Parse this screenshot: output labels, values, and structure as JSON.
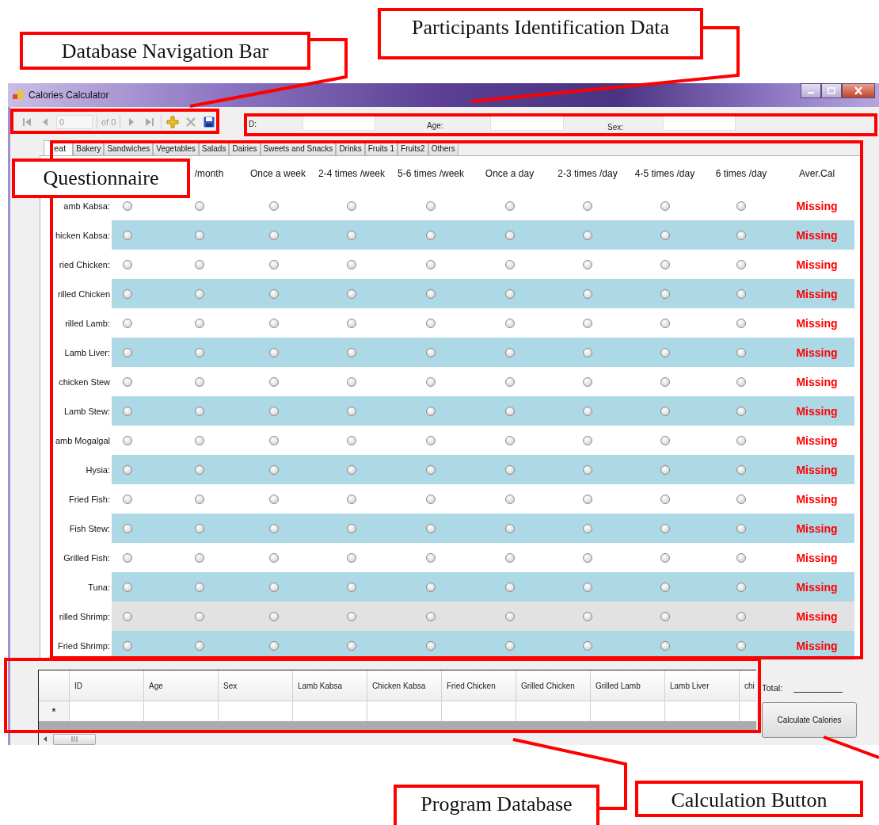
{
  "window": {
    "title": "Calories Calculator"
  },
  "navigator": {
    "items": [
      {
        "kind": "first",
        "disabled": true
      },
      {
        "kind": "previous",
        "disabled": true
      },
      {
        "kind": "position",
        "value": "0"
      },
      {
        "kind": "count",
        "text": "of 0"
      },
      {
        "kind": "next",
        "disabled": true
      },
      {
        "kind": "last",
        "disabled": true
      },
      {
        "kind": "add",
        "disabled": false
      },
      {
        "kind": "delete",
        "disabled": true
      },
      {
        "kind": "save",
        "disabled": false
      }
    ]
  },
  "participant": {
    "fields": [
      {
        "label": "D:"
      },
      {
        "label": "Age:"
      },
      {
        "label": "Sex:"
      }
    ]
  },
  "tabs": [
    {
      "label": "eat",
      "selected": true
    },
    {
      "label": "Bakery",
      "selected": false
    },
    {
      "label": "Sandwiches",
      "selected": false
    },
    {
      "label": "Vegetables",
      "selected": false
    },
    {
      "label": "Salads",
      "selected": false
    },
    {
      "label": "Dairies",
      "selected": false
    },
    {
      "label": "Sweets and Snacks",
      "selected": false
    },
    {
      "label": "Drinks",
      "selected": false
    },
    {
      "label": "Fruits 1",
      "selected": false
    },
    {
      "label": "Fruits2",
      "selected": false
    },
    {
      "label": "Others",
      "selected": false
    }
  ],
  "questionnaire": {
    "columns": [
      {
        "kind": "option"
      },
      {
        "kind": "option",
        "header": "/month"
      },
      {
        "kind": "option",
        "header": "Once a week"
      },
      {
        "kind": "option",
        "header": "2-4 times /week"
      },
      {
        "kind": "option",
        "header": "5-6 times /week"
      },
      {
        "kind": "option",
        "header": "Once a day"
      },
      {
        "kind": "option",
        "header": "2-3 times /day"
      },
      {
        "kind": "option",
        "header": "4-5 times /day"
      },
      {
        "kind": "option",
        "header": "6 times /day"
      },
      {
        "kind": "average",
        "header": "Aver.Cal"
      }
    ],
    "rows": [
      {
        "label": "amb Kabsa:",
        "striped": false,
        "hovered": false,
        "average": "Missing",
        "options": [
          {
            "selected": false
          },
          {
            "selected": false
          },
          {
            "selected": false
          },
          {
            "selected": false
          },
          {
            "selected": false
          },
          {
            "selected": false
          },
          {
            "selected": false
          },
          {
            "selected": false
          },
          {
            "selected": false
          }
        ]
      },
      {
        "label": "hicken Kabsa:",
        "striped": true,
        "hovered": false,
        "average": "Missing",
        "options": [
          {
            "selected": false
          },
          {
            "selected": false
          },
          {
            "selected": false
          },
          {
            "selected": false
          },
          {
            "selected": false
          },
          {
            "selected": false
          },
          {
            "selected": false
          },
          {
            "selected": false
          },
          {
            "selected": false
          }
        ]
      },
      {
        "label": "ried Chicken:",
        "striped": false,
        "hovered": false,
        "average": "Missing",
        "options": [
          {
            "selected": false
          },
          {
            "selected": false
          },
          {
            "selected": false
          },
          {
            "selected": false
          },
          {
            "selected": false
          },
          {
            "selected": false
          },
          {
            "selected": false
          },
          {
            "selected": false
          },
          {
            "selected": false
          }
        ]
      },
      {
        "label": "rilled Chicken",
        "striped": true,
        "hovered": false,
        "average": "Missing",
        "options": [
          {
            "selected": false
          },
          {
            "selected": false
          },
          {
            "selected": false
          },
          {
            "selected": false
          },
          {
            "selected": false
          },
          {
            "selected": false
          },
          {
            "selected": false
          },
          {
            "selected": false
          },
          {
            "selected": false
          }
        ]
      },
      {
        "label": "rilled Lamb:",
        "striped": false,
        "hovered": false,
        "average": "Missing",
        "options": [
          {
            "selected": false
          },
          {
            "selected": false
          },
          {
            "selected": false
          },
          {
            "selected": false
          },
          {
            "selected": false
          },
          {
            "selected": false
          },
          {
            "selected": false
          },
          {
            "selected": false
          },
          {
            "selected": false
          }
        ]
      },
      {
        "label": "Lamb Liver:",
        "striped": true,
        "hovered": false,
        "average": "Missing",
        "options": [
          {
            "selected": false
          },
          {
            "selected": false
          },
          {
            "selected": false
          },
          {
            "selected": false
          },
          {
            "selected": false
          },
          {
            "selected": false
          },
          {
            "selected": false
          },
          {
            "selected": false
          },
          {
            "selected": false
          }
        ]
      },
      {
        "label": "chicken Stew",
        "striped": false,
        "hovered": false,
        "average": "Missing",
        "options": [
          {
            "selected": false
          },
          {
            "selected": false
          },
          {
            "selected": false
          },
          {
            "selected": false
          },
          {
            "selected": false
          },
          {
            "selected": false
          },
          {
            "selected": false
          },
          {
            "selected": false
          },
          {
            "selected": false
          }
        ]
      },
      {
        "label": "Lamb Stew:",
        "striped": true,
        "hovered": false,
        "average": "Missing",
        "options": [
          {
            "selected": false
          },
          {
            "selected": false
          },
          {
            "selected": false
          },
          {
            "selected": false
          },
          {
            "selected": false
          },
          {
            "selected": false
          },
          {
            "selected": false
          },
          {
            "selected": false
          },
          {
            "selected": false
          }
        ]
      },
      {
        "label": "amb Mogalgal",
        "striped": false,
        "hovered": false,
        "average": "Missing",
        "options": [
          {
            "selected": false
          },
          {
            "selected": false
          },
          {
            "selected": false
          },
          {
            "selected": false
          },
          {
            "selected": false
          },
          {
            "selected": false
          },
          {
            "selected": false
          },
          {
            "selected": false
          },
          {
            "selected": false
          }
        ]
      },
      {
        "label": "Hysia:",
        "striped": true,
        "hovered": false,
        "average": "Missing",
        "options": [
          {
            "selected": false
          },
          {
            "selected": false
          },
          {
            "selected": false
          },
          {
            "selected": false
          },
          {
            "selected": false
          },
          {
            "selected": false
          },
          {
            "selected": false
          },
          {
            "selected": false
          },
          {
            "selected": false
          }
        ]
      },
      {
        "label": "Fried Fish:",
        "striped": false,
        "hovered": false,
        "average": "Missing",
        "options": [
          {
            "selected": false
          },
          {
            "selected": false
          },
          {
            "selected": false
          },
          {
            "selected": false
          },
          {
            "selected": false
          },
          {
            "selected": false
          },
          {
            "selected": false
          },
          {
            "selected": false
          },
          {
            "selected": false
          }
        ]
      },
      {
        "label": "Fish Stew:",
        "striped": true,
        "hovered": false,
        "average": "Missing",
        "options": [
          {
            "selected": false
          },
          {
            "selected": false
          },
          {
            "selected": false
          },
          {
            "selected": false
          },
          {
            "selected": false
          },
          {
            "selected": false
          },
          {
            "selected": false
          },
          {
            "selected": false
          },
          {
            "selected": false
          }
        ]
      },
      {
        "label": "Grilled Fish:",
        "striped": false,
        "hovered": false,
        "average": "Missing",
        "options": [
          {
            "selected": false
          },
          {
            "selected": false
          },
          {
            "selected": false
          },
          {
            "selected": false
          },
          {
            "selected": false
          },
          {
            "selected": false
          },
          {
            "selected": false
          },
          {
            "selected": false
          },
          {
            "selected": false
          }
        ]
      },
      {
        "label": "Tuna:",
        "striped": true,
        "hovered": false,
        "average": "Missing",
        "options": [
          {
            "selected": false
          },
          {
            "selected": false
          },
          {
            "selected": false
          },
          {
            "selected": false
          },
          {
            "selected": false
          },
          {
            "selected": false
          },
          {
            "selected": false
          },
          {
            "selected": false
          },
          {
            "selected": false
          }
        ]
      },
      {
        "label": "rilled Shrimp:",
        "striped": false,
        "hovered": true,
        "average": "Missing",
        "options": [
          {
            "selected": false
          },
          {
            "selected": false
          },
          {
            "selected": false
          },
          {
            "selected": false
          },
          {
            "selected": false
          },
          {
            "selected": false
          },
          {
            "selected": false
          },
          {
            "selected": false
          },
          {
            "selected": false
          }
        ]
      },
      {
        "label": "Fried Shrimp:",
        "striped": true,
        "hovered": false,
        "average": "Missing",
        "options": [
          {
            "selected": false
          },
          {
            "selected": false
          },
          {
            "selected": false
          },
          {
            "selected": false
          },
          {
            "selected": false
          },
          {
            "selected": false
          },
          {
            "selected": false
          },
          {
            "selected": false
          },
          {
            "selected": false
          }
        ]
      }
    ]
  },
  "database": {
    "columns": [
      "ID",
      "Age",
      "Sex",
      "Lamb Kabsa",
      "Chicken Kabsa",
      "Fried Chicken",
      "Grilled Chicken",
      "Grilled Lamb",
      "Lamb Liver",
      "chi"
    ],
    "new_row_marker": "*"
  },
  "total": {
    "label": "Total:"
  },
  "calculate_button": "Calculate Calories",
  "annotations": [
    "Database Navigation Bar",
    "Participants Identification Data",
    "Questionnaire",
    "Program Database",
    "Calculation Button"
  ]
}
